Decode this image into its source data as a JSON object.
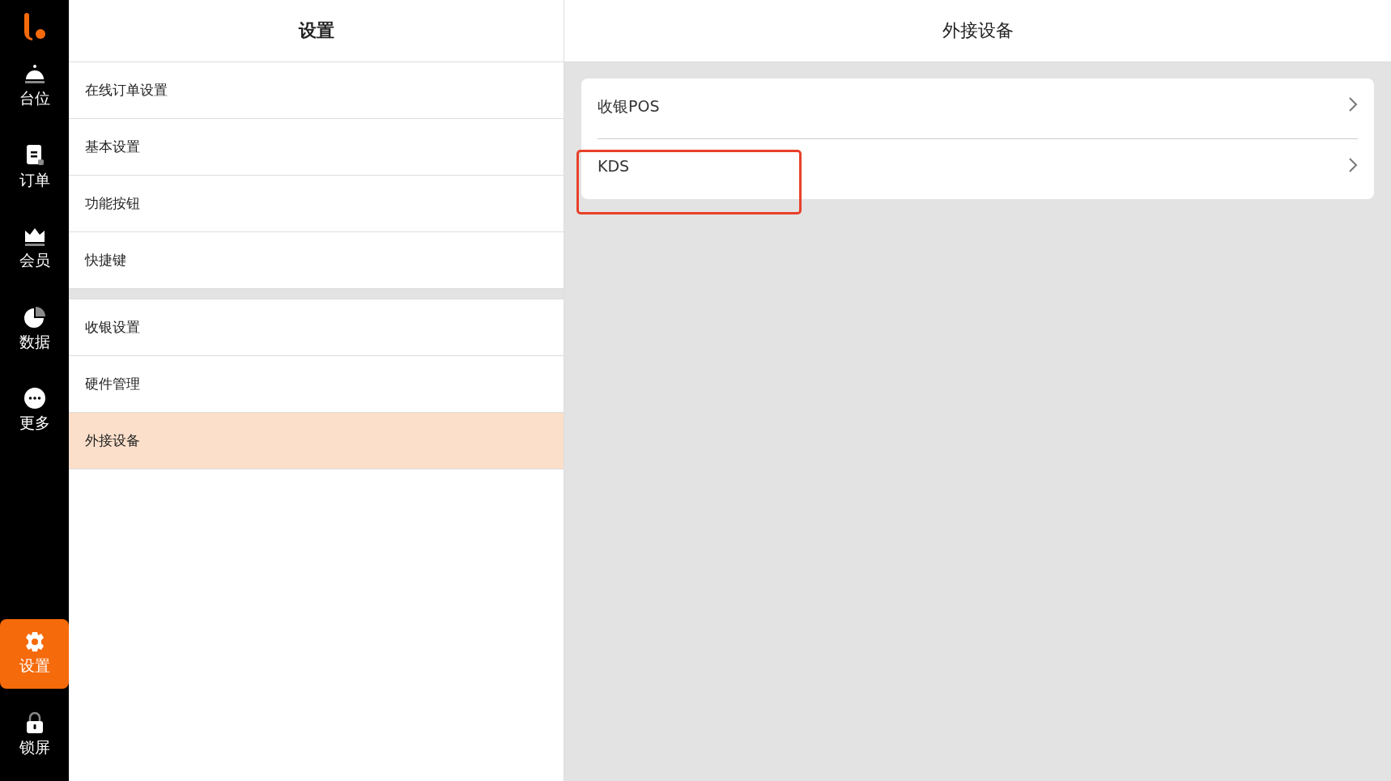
{
  "nav": [
    {
      "kind": "table",
      "label": "台位",
      "selected": false
    },
    {
      "kind": "order",
      "label": "订单",
      "selected": false
    },
    {
      "kind": "member",
      "label": "会员",
      "selected": false
    },
    {
      "kind": "data",
      "label": "数据",
      "selected": false
    },
    {
      "kind": "more",
      "label": "更多",
      "selected": false
    },
    {
      "kind": "settings",
      "label": "设置",
      "selected": true
    },
    {
      "kind": "lock",
      "label": "锁屏",
      "selected": false
    }
  ],
  "settings": {
    "title": "设置",
    "groups": [
      [
        {
          "label": "在线订单设置",
          "selected": false
        },
        {
          "label": "基本设置",
          "selected": false
        },
        {
          "label": "功能按钮",
          "selected": false
        },
        {
          "label": "快捷键",
          "selected": false
        }
      ],
      [
        {
          "label": "收银设置",
          "selected": false
        },
        {
          "label": "硬件管理",
          "selected": false
        },
        {
          "label": "外接设备",
          "selected": true
        }
      ]
    ]
  },
  "detail": {
    "title": "外接设备",
    "items": [
      {
        "label": "收银POS",
        "highlighted": false
      },
      {
        "label": "KDS",
        "highlighted": true
      }
    ]
  }
}
